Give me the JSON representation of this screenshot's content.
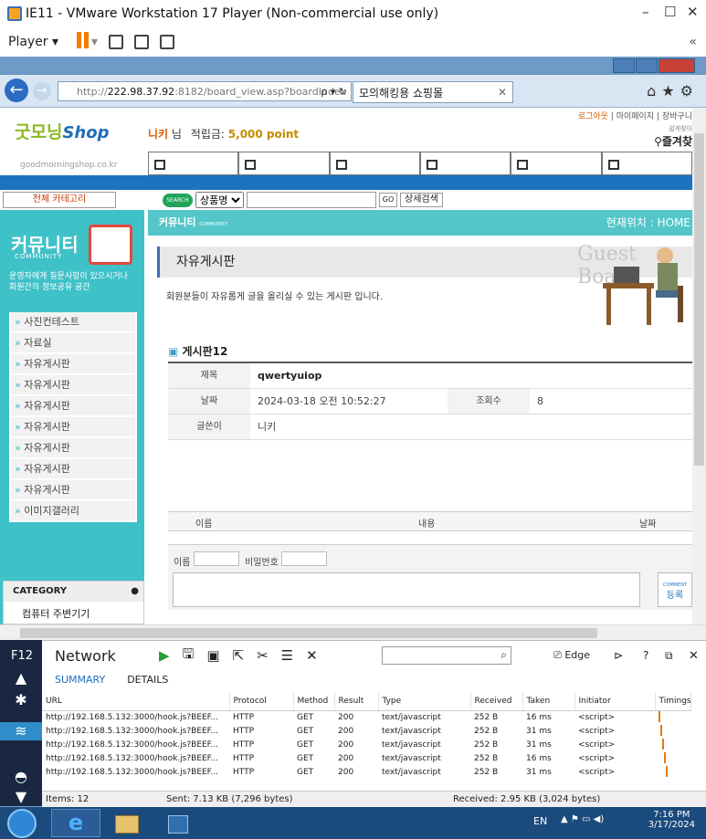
{
  "window": {
    "title": "IE11 - VMware Workstation 17 Player (Non-commercial use only)",
    "min": "–",
    "max": "☐",
    "close": "✕"
  },
  "vm_toolbar": {
    "player_label": "Player ▾",
    "right_icon": "«"
  },
  "browser": {
    "address": "http://",
    "address_host": "222.98.37.92",
    "address_rest": ":8182/board_view.asp?boardIndex",
    "address_controls": "⍴ ▾ ↻",
    "tab_title": "모의해킹용 쇼핑몰",
    "tab_close": "✕",
    "right_icons": "⌂★⚙"
  },
  "site": {
    "toplinks": {
      "logout": "로그아웃",
      "mypage": "마이페이지",
      "cart": "장바구니"
    },
    "bookmark_hint": "쉽게찾아",
    "bookmark_label": "즐겨찾",
    "logo_kr": "굿모닝",
    "logo_shop": "Shop",
    "logo_url": "goodmorningshop.co.kr",
    "user": {
      "nick": "니키",
      "suffix": " 님",
      "points_label": "적립금:",
      "points": "5,000 point"
    },
    "category_btn": "전체 카테고리",
    "search": {
      "badge": "SEARCH",
      "select": "상품명",
      "go": "GO",
      "advanced": "상세검색"
    },
    "sidebar": {
      "title": "커뮤니티",
      "sub": "COMMUNITY",
      "desc1": "운영자에게 질문사항이 있으시거나",
      "desc2": "회원간의 정보공유 공간",
      "items": [
        "사진컨테스트",
        "자료실",
        "자유게시판",
        "자유게시판",
        "자유게시판",
        "자유게시판",
        "자유게시판",
        "자유게시판",
        "자유게시판",
        "이미지갤러리"
      ]
    },
    "category": {
      "header": "CATEGORY",
      "first": "컴퓨터 주변기기"
    },
    "community_bar": {
      "label": "커뮤니티",
      "sub": "COMMUNITY",
      "location_label": "현재위치 :",
      "location": "HOME"
    },
    "board": {
      "title": "자유게시판",
      "desc": "회원분들이 자유롭게 글을 올리실 수 있는 게시판 입니다.",
      "guest": "Guest Board",
      "post_heading": "게시판12"
    },
    "post": {
      "subject_label": "제목",
      "subject": "qwertyuiop",
      "date_label": "날짜",
      "date": "2024-03-18 오전 10:52:27",
      "views_label": "조회수",
      "views": "8",
      "author_label": "글쓴이",
      "author": "니키"
    },
    "comments": {
      "name_col": "이름",
      "content_col": "내용",
      "date_col": "날짜",
      "name_label": "이름",
      "pw_label": "비밀번호",
      "submit_top": "COMMENT",
      "submit": "등록"
    }
  },
  "devtools": {
    "label": "F12",
    "panel": "Network",
    "edge": "Edge",
    "help": "?",
    "subtabs": [
      "SUMMARY",
      "DETAILS"
    ],
    "columns": [
      "URL",
      "Protocol",
      "Method",
      "Result",
      "Type",
      "Received",
      "Taken",
      "Initiator",
      "Timings"
    ],
    "rows": [
      [
        "http://192.168.5.132:3000/hook.js?BEEF...",
        "HTTP",
        "GET",
        "200",
        "text/javascript",
        "252 B",
        "16 ms",
        "<script>"
      ],
      [
        "http://192.168.5.132:3000/hook.js?BEEF...",
        "HTTP",
        "GET",
        "200",
        "text/javascript",
        "252 B",
        "31 ms",
        "<script>"
      ],
      [
        "http://192.168.5.132:3000/hook.js?BEEF...",
        "HTTP",
        "GET",
        "200",
        "text/javascript",
        "252 B",
        "31 ms",
        "<script>"
      ],
      [
        "http://192.168.5.132:3000/hook.js?BEEF...",
        "HTTP",
        "GET",
        "200",
        "text/javascript",
        "252 B",
        "16 ms",
        "<script>"
      ],
      [
        "http://192.168.5.132:3000/hook.js?BEEF...",
        "HTTP",
        "GET",
        "200",
        "text/javascript",
        "252 B",
        "31 ms",
        "<script>"
      ]
    ],
    "status": {
      "items": "Items: 12",
      "sent": "Sent: 7.13 KB (7,296 bytes)",
      "received": "Received: 2.95 KB (3,024 bytes)"
    }
  },
  "taskbar": {
    "lang": "EN",
    "time": "7:16 PM",
    "date": "3/17/2024"
  }
}
